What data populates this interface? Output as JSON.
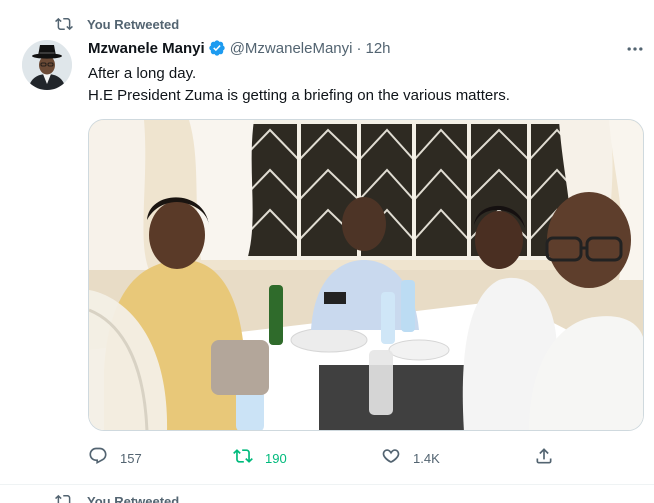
{
  "tweet": {
    "retweet_label": "You Retweeted",
    "author_name": "Mzwanele Manyi",
    "author_handle": "@MzwaneleManyi",
    "separator": "·",
    "time": "12h",
    "text_line1": "After a long day.",
    "text_line2": "H.E President Zuma is getting a briefing on the various matters.",
    "actions": {
      "replies": "157",
      "retweets": "190",
      "likes": "1.4K"
    }
  },
  "next_tweet": {
    "retweet_label": "You Retweeted"
  },
  "colors": {
    "text_primary": "#0f1419",
    "text_secondary": "#536471",
    "verified_blue": "#1d9bf0",
    "retweet_green": "#00ba7c"
  },
  "icons": {
    "retweet": "retweet-icon",
    "verified": "verified-badge-icon",
    "more": "more-icon",
    "reply": "reply-icon",
    "like": "heart-icon",
    "share": "share-icon"
  }
}
